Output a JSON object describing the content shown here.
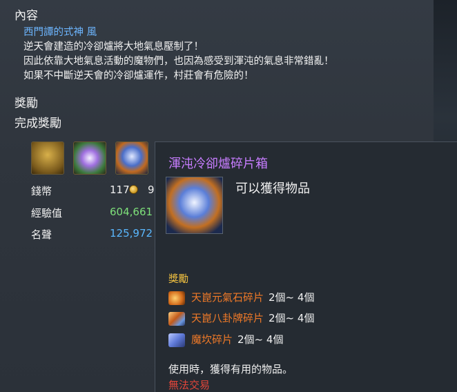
{
  "content": {
    "heading": "內容",
    "npc": "西門譚的式神  風",
    "lines": [
      "逆天會建造的冷卻爐將大地氣息壓制了！",
      "因此依靠大地氣息活動的魔物們，也因為感受到渾沌的氣息非常錯亂！",
      "如果不中斷逆天會的冷卻爐運作，村莊會有危險的！"
    ]
  },
  "rewards": {
    "heading": "獎勵",
    "sub_heading": "完成獎勵",
    "icons": [
      "golden-chest-icon",
      "crystal-icon",
      "chaos-cooler-fragment-box-icon"
    ],
    "stats": [
      {
        "label": "錢幣",
        "value": "117",
        "value_cut": "9",
        "color": "#f0f0f0"
      },
      {
        "label": "經驗值",
        "value": "604,661",
        "color": "#7ee07a"
      },
      {
        "label": "名聲",
        "value": "125,972",
        "color": "#5ab8ff"
      }
    ]
  },
  "tooltip": {
    "title": "渾沌冷卻爐碎片箱",
    "description": "可以獲得物品",
    "reward_heading": "獎勵",
    "items": [
      {
        "icon": "stone-fragment-icon",
        "name": "天崑元氣石碎片",
        "qty": "2個~  4個"
      },
      {
        "icon": "bagua-plate-fragment-icon",
        "name": "天崑八卦牌碎片",
        "qty": "2個~  4個"
      },
      {
        "icon": "demon-shard-icon",
        "name": "魔坎碎片",
        "qty": "2個~  4個"
      }
    ],
    "usage": "使用時，獲得有用的物品。",
    "trade": "無法交易"
  }
}
